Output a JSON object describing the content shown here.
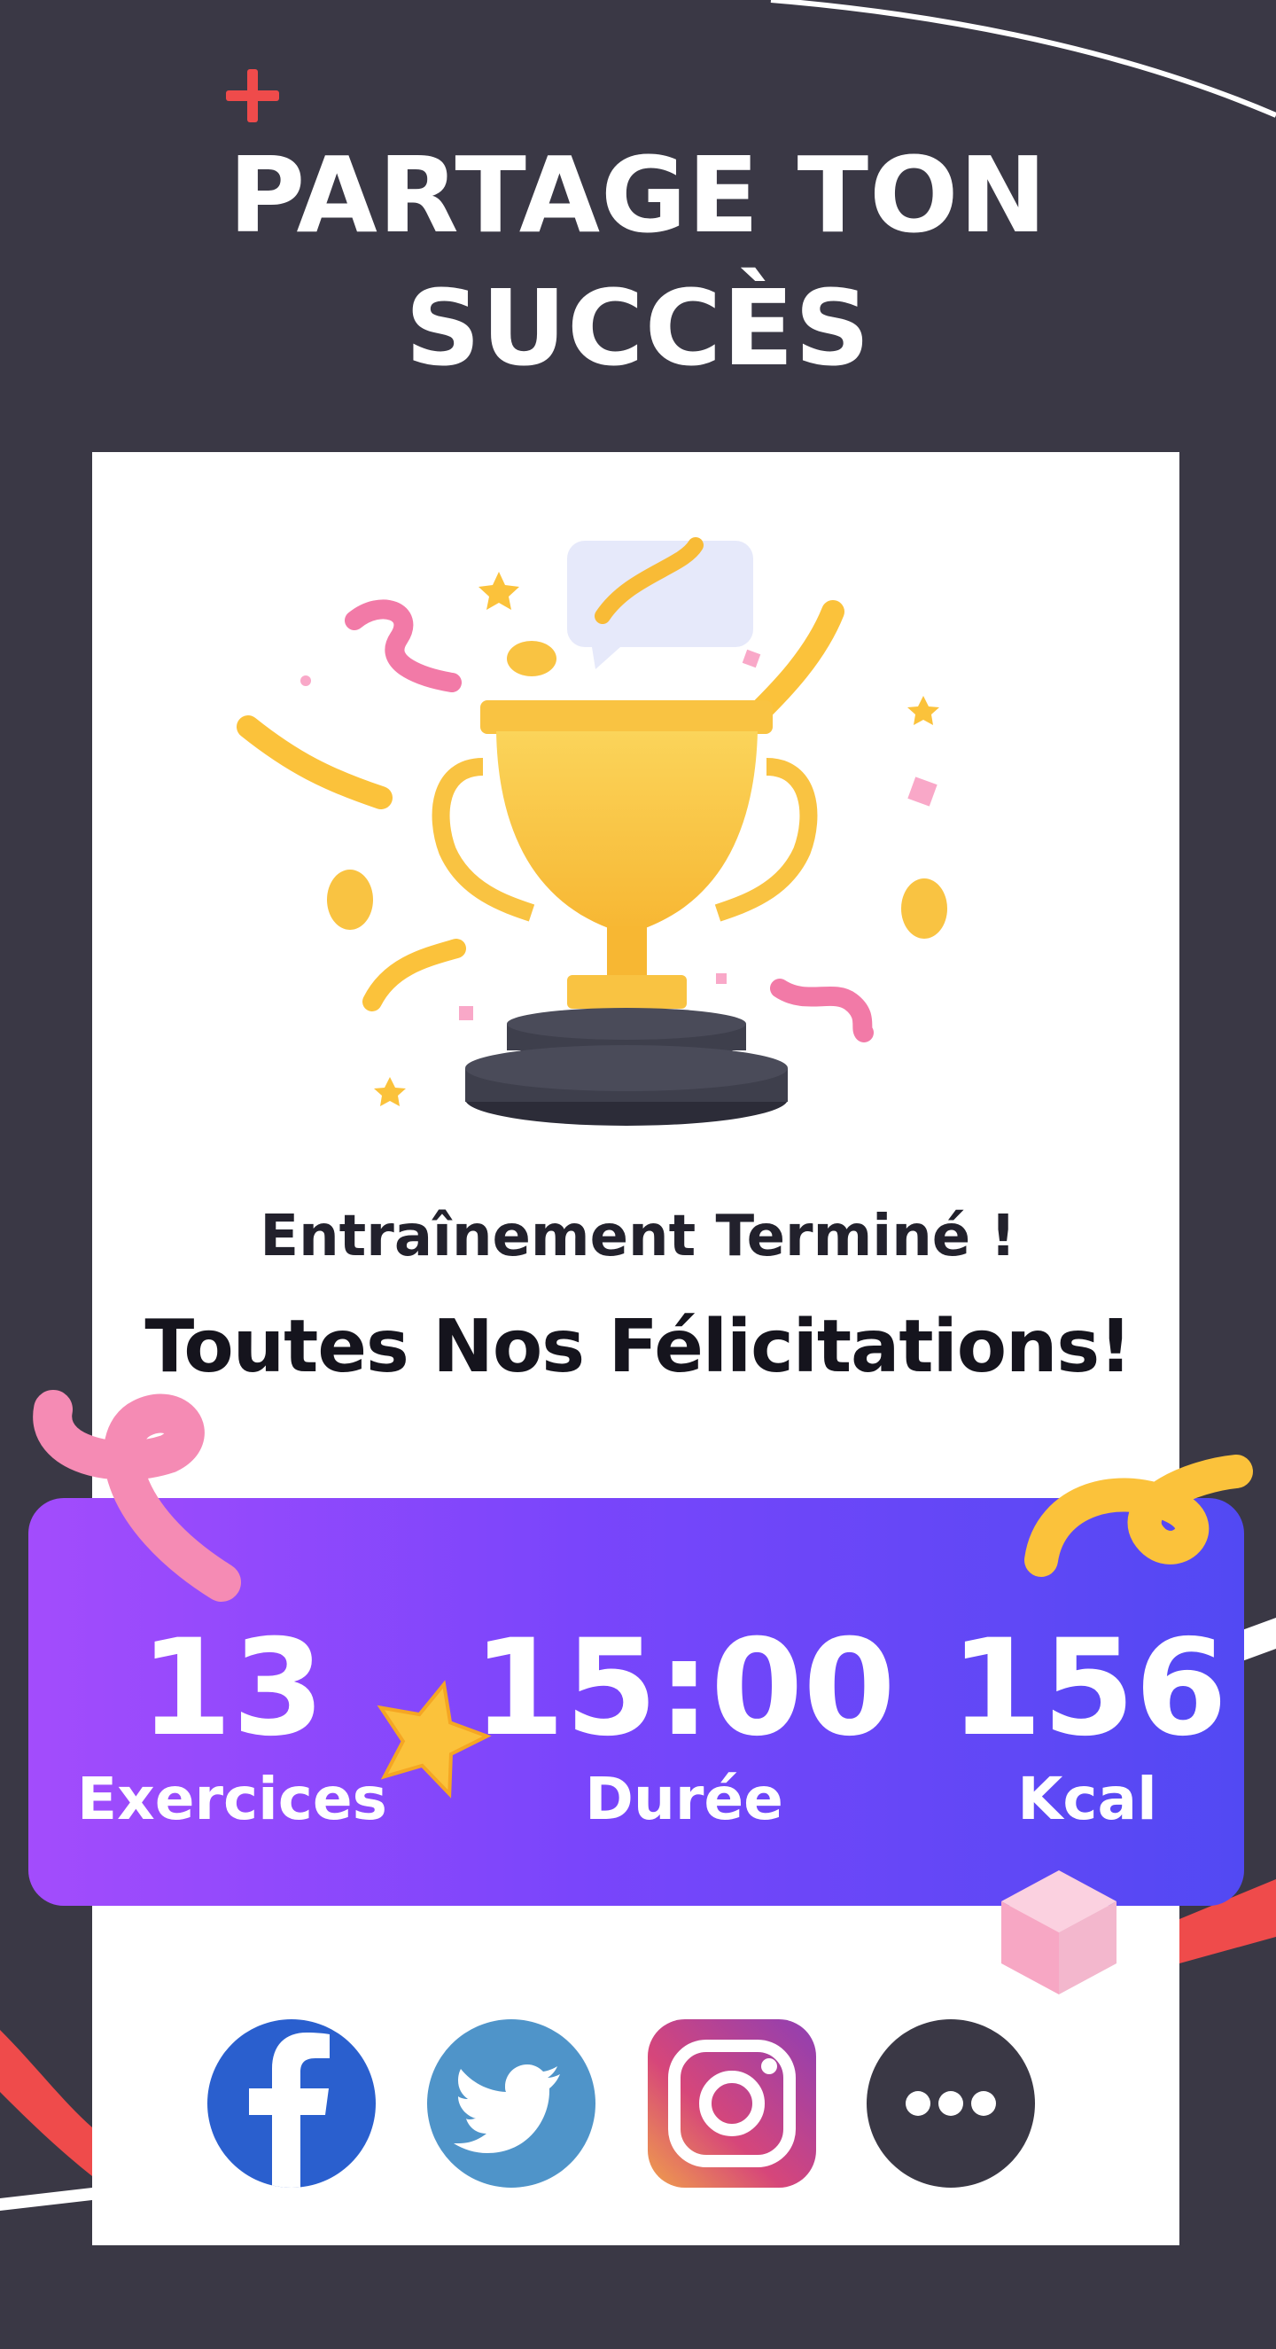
{
  "header": {
    "title_line1": "PARTAGE TON",
    "title_line2": "SUCCÈS"
  },
  "card": {
    "subtitle": "Entraînement Terminé !",
    "congrats": "Toutes Nos Félicitations!"
  },
  "stats": [
    {
      "value": "13",
      "label": "Exercices"
    },
    {
      "value": "15:00",
      "label": "Durée"
    },
    {
      "value": "156",
      "label": "Kcal"
    }
  ],
  "share": {
    "icons": [
      "facebook-icon",
      "twitter-icon",
      "instagram-icon",
      "more-icon"
    ]
  },
  "colors": {
    "background": "#3a3845",
    "accent_red": "#ef4b4b",
    "panel_start": "#a34cfc",
    "panel_end": "#5249f3",
    "trophy_gold": "#fbc93f",
    "facebook": "#2a5fce",
    "twitter": "#4f94c9",
    "more": "#3a3845"
  }
}
